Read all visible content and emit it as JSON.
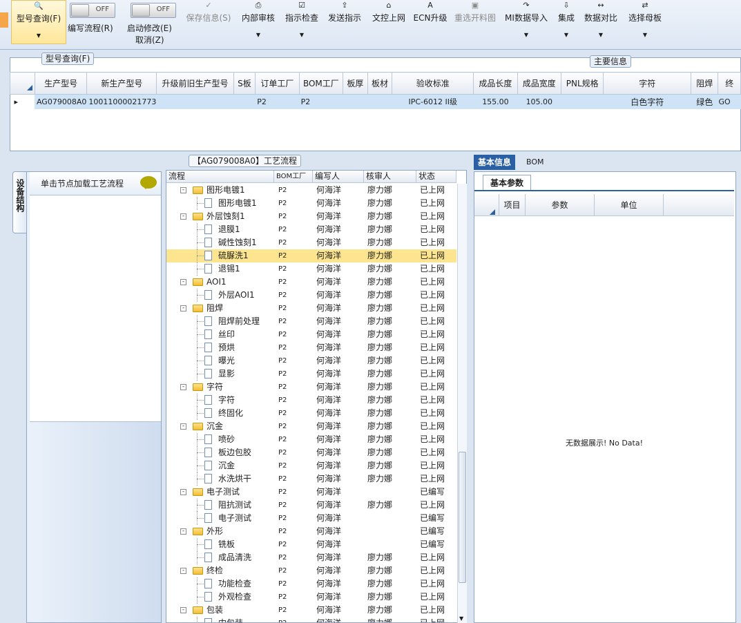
{
  "ribbon": {
    "model_query": "型号查询(F)",
    "toggle1_state": "OFF",
    "toggle1_label": "编写流程(R)",
    "toggle2_state": "OFF",
    "toggle2_label": "启动修改(E)",
    "cancel_label": "取消(Z)",
    "save_info": "保存信息(S)",
    "internal_review": "内部审核",
    "instruction_check": "指示检查",
    "send_instruction": "发送指示",
    "upload_doc": "文控上网",
    "ecn_upgrade": "ECN升级",
    "reselect_cut_map": "重选开料图",
    "mi_import": "MI数据导入",
    "integrate": "集成",
    "data_compare": "数据对比",
    "select_mother_board": "选择母板"
  },
  "top_grid": {
    "group_title": "型号查询(F)",
    "main_info_title": "主要信息",
    "columns": [
      "生产型号",
      "新生产型号",
      "升级前旧生产型号",
      "S板",
      "订单工厂",
      "BOM工厂",
      "板厚",
      "板材",
      "验收标准",
      "成品长度",
      "成品宽度",
      "PNL规格",
      "字符",
      "阻焊",
      "终"
    ],
    "row": [
      "AG079008A0",
      "10011000021773",
      "",
      "",
      "P2",
      "P2",
      "",
      "",
      "IPC-6012 II级",
      "155.00",
      "105.00",
      "",
      "白色字符",
      "绿色",
      "GO"
    ]
  },
  "left_panel": {
    "vertical_tab": "设备结构",
    "header": "单击节点加载工艺流程"
  },
  "tree": {
    "title": "【AG079008A0】工艺流程",
    "columns": [
      "流程",
      "BOM工厂",
      "编写人",
      "核审人",
      "状态"
    ],
    "rows": [
      {
        "name": "图形电镀1",
        "folder": true,
        "bom": "P2",
        "writer": "何海洋",
        "reviewer": "廖力娜",
        "status": "已上网"
      },
      {
        "name": "图形电镀1",
        "folder": false,
        "bom": "P2",
        "writer": "何海洋",
        "reviewer": "廖力娜",
        "status": "已上网"
      },
      {
        "name": "外层蚀刻1",
        "folder": true,
        "bom": "P2",
        "writer": "何海洋",
        "reviewer": "廖力娜",
        "status": "已上网"
      },
      {
        "name": "退膜1",
        "folder": false,
        "bom": "P2",
        "writer": "何海洋",
        "reviewer": "廖力娜",
        "status": "已上网"
      },
      {
        "name": "碱性蚀刻1",
        "folder": false,
        "bom": "P2",
        "writer": "何海洋",
        "reviewer": "廖力娜",
        "status": "已上网"
      },
      {
        "name": "硫脲洗1",
        "folder": false,
        "bom": "P2",
        "writer": "何海洋",
        "reviewer": "廖力娜",
        "status": "已上网",
        "selected": true
      },
      {
        "name": "退锡1",
        "folder": false,
        "bom": "P2",
        "writer": "何海洋",
        "reviewer": "廖力娜",
        "status": "已上网"
      },
      {
        "name": "AOI1",
        "folder": true,
        "bom": "P2",
        "writer": "何海洋",
        "reviewer": "廖力娜",
        "status": "已上网"
      },
      {
        "name": "外层AOI1",
        "folder": false,
        "bom": "P2",
        "writer": "何海洋",
        "reviewer": "廖力娜",
        "status": "已上网"
      },
      {
        "name": "阻焊",
        "folder": true,
        "bom": "P2",
        "writer": "何海洋",
        "reviewer": "廖力娜",
        "status": "已上网"
      },
      {
        "name": "阻焊前处理",
        "folder": false,
        "bom": "P2",
        "writer": "何海洋",
        "reviewer": "廖力娜",
        "status": "已上网"
      },
      {
        "name": "丝印",
        "folder": false,
        "bom": "P2",
        "writer": "何海洋",
        "reviewer": "廖力娜",
        "status": "已上网"
      },
      {
        "name": "预烘",
        "folder": false,
        "bom": "P2",
        "writer": "何海洋",
        "reviewer": "廖力娜",
        "status": "已上网"
      },
      {
        "name": "曝光",
        "folder": false,
        "bom": "P2",
        "writer": "何海洋",
        "reviewer": "廖力娜",
        "status": "已上网"
      },
      {
        "name": "显影",
        "folder": false,
        "bom": "P2",
        "writer": "何海洋",
        "reviewer": "廖力娜",
        "status": "已上网"
      },
      {
        "name": "字符",
        "folder": true,
        "bom": "P2",
        "writer": "何海洋",
        "reviewer": "廖力娜",
        "status": "已上网"
      },
      {
        "name": "字符",
        "folder": false,
        "bom": "P2",
        "writer": "何海洋",
        "reviewer": "廖力娜",
        "status": "已上网"
      },
      {
        "name": "终固化",
        "folder": false,
        "bom": "P2",
        "writer": "何海洋",
        "reviewer": "廖力娜",
        "status": "已上网"
      },
      {
        "name": "沉金",
        "folder": true,
        "bom": "P2",
        "writer": "何海洋",
        "reviewer": "廖力娜",
        "status": "已上网"
      },
      {
        "name": "喷砂",
        "folder": false,
        "bom": "P2",
        "writer": "何海洋",
        "reviewer": "廖力娜",
        "status": "已上网"
      },
      {
        "name": "板边包胶",
        "folder": false,
        "bom": "P2",
        "writer": "何海洋",
        "reviewer": "廖力娜",
        "status": "已上网"
      },
      {
        "name": "沉金",
        "folder": false,
        "bom": "P2",
        "writer": "何海洋",
        "reviewer": "廖力娜",
        "status": "已上网"
      },
      {
        "name": "水洗烘干",
        "folder": false,
        "bom": "P2",
        "writer": "何海洋",
        "reviewer": "廖力娜",
        "status": "已上网"
      },
      {
        "name": "电子测试",
        "folder": true,
        "bom": "P2",
        "writer": "何海洋",
        "reviewer": "",
        "status": "已编写"
      },
      {
        "name": "阻抗测试",
        "folder": false,
        "bom": "P2",
        "writer": "何海洋",
        "reviewer": "廖力娜",
        "status": "已上网"
      },
      {
        "name": "电子测试",
        "folder": false,
        "bom": "P2",
        "writer": "何海洋",
        "reviewer": "",
        "status": "已编写"
      },
      {
        "name": "外形",
        "folder": true,
        "bom": "P2",
        "writer": "何海洋",
        "reviewer": "",
        "status": "已编写"
      },
      {
        "name": "铣板",
        "folder": false,
        "bom": "P2",
        "writer": "何海洋",
        "reviewer": "",
        "status": "已编写"
      },
      {
        "name": "成品清洗",
        "folder": false,
        "bom": "P2",
        "writer": "何海洋",
        "reviewer": "廖力娜",
        "status": "已上网"
      },
      {
        "name": "终检",
        "folder": true,
        "bom": "P2",
        "writer": "何海洋",
        "reviewer": "廖力娜",
        "status": "已上网"
      },
      {
        "name": "功能检查",
        "folder": false,
        "bom": "P2",
        "writer": "何海洋",
        "reviewer": "廖力娜",
        "status": "已上网"
      },
      {
        "name": "外观检查",
        "folder": false,
        "bom": "P2",
        "writer": "何海洋",
        "reviewer": "廖力娜",
        "status": "已上网"
      },
      {
        "name": "包装",
        "folder": true,
        "bom": "P2",
        "writer": "何海洋",
        "reviewer": "廖力娜",
        "status": "已上网"
      },
      {
        "name": "内包装",
        "folder": false,
        "bom": "P2",
        "writer": "何海洋",
        "reviewer": "廖力娜",
        "status": "已上网"
      }
    ]
  },
  "right_panel": {
    "tab_basic": "基本信息",
    "tab_bom": "BOM",
    "subtab": "基本参数",
    "columns": [
      "项目",
      "参数",
      "单位"
    ],
    "no_data": "无数据展示! No Data!"
  },
  "colors": {
    "selection": "#fde58f",
    "grid_row": "#cfe3f7",
    "tab_active": "#2a5fa3"
  }
}
